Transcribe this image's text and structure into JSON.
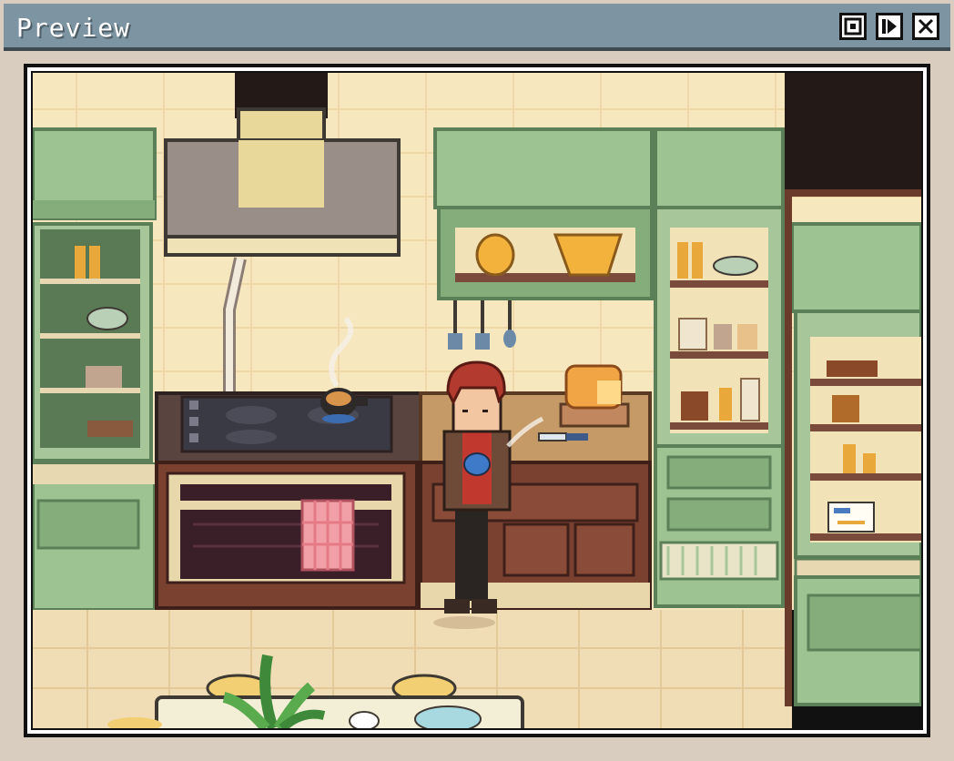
{
  "window": {
    "title": "Preview",
    "controls": [
      {
        "name": "fullscreen-button",
        "icon": "fullscreen-icon"
      },
      {
        "name": "play-button",
        "icon": "play-icon"
      },
      {
        "name": "close-button",
        "icon": "close-icon"
      }
    ],
    "colors": {
      "titlebar": "#7d95a3",
      "frame": "#d9cdbf",
      "wall": "#f7e7bf",
      "cabinet_green": "#9cc391",
      "wood": "#6a3a2a",
      "floor": "#f0ddb6"
    }
  },
  "scene": {
    "location": "kitchen",
    "objects": [
      "range-hood",
      "stove",
      "oven",
      "kettle",
      "pink-towel",
      "bread-loaf",
      "knife",
      "shelves",
      "player-character",
      "potted-plant",
      "dining-table"
    ]
  }
}
